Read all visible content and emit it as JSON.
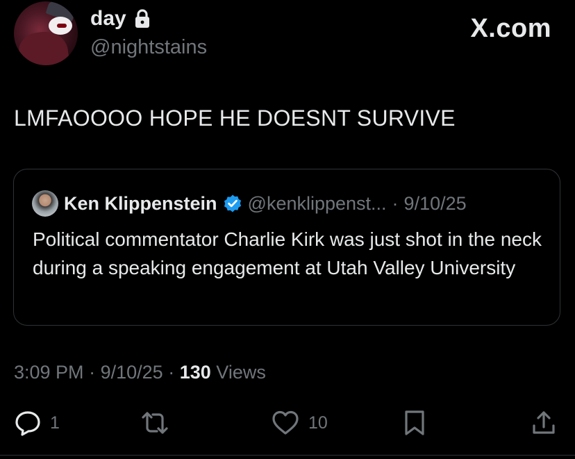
{
  "author": {
    "display_name": "day",
    "handle": "@nightstains",
    "protected_icon": "lock-icon"
  },
  "brand": "X.com",
  "tweet": {
    "text": "LMFAOOOO HOPE HE DOESNT SURVIVE"
  },
  "quoted_tweet": {
    "display_name": "Ken Klippenstein",
    "verified_icon": "verified-badge-icon",
    "handle": "@kenklippenst...",
    "separator": "·",
    "date": "9/10/25",
    "text": "Political commentator Charlie Kirk was just shot in the neck during a speaking engagement at Utah Valley University"
  },
  "meta": {
    "time": "3:09 PM",
    "sep1": "·",
    "date": "9/10/25",
    "sep2": "·",
    "views_count": "130",
    "views_label": "Views"
  },
  "actions": {
    "reply_icon": "reply-icon",
    "reply_count": "1",
    "retweet_icon": "retweet-icon",
    "like_icon": "heart-icon",
    "like_count": "10",
    "bookmark_icon": "bookmark-icon",
    "share_icon": "share-icon"
  },
  "colors": {
    "background": "#000000",
    "primary_text": "#e7e9ea",
    "secondary_text": "#71767b",
    "border": "#2f3336",
    "verified": "#1d9bf0"
  }
}
